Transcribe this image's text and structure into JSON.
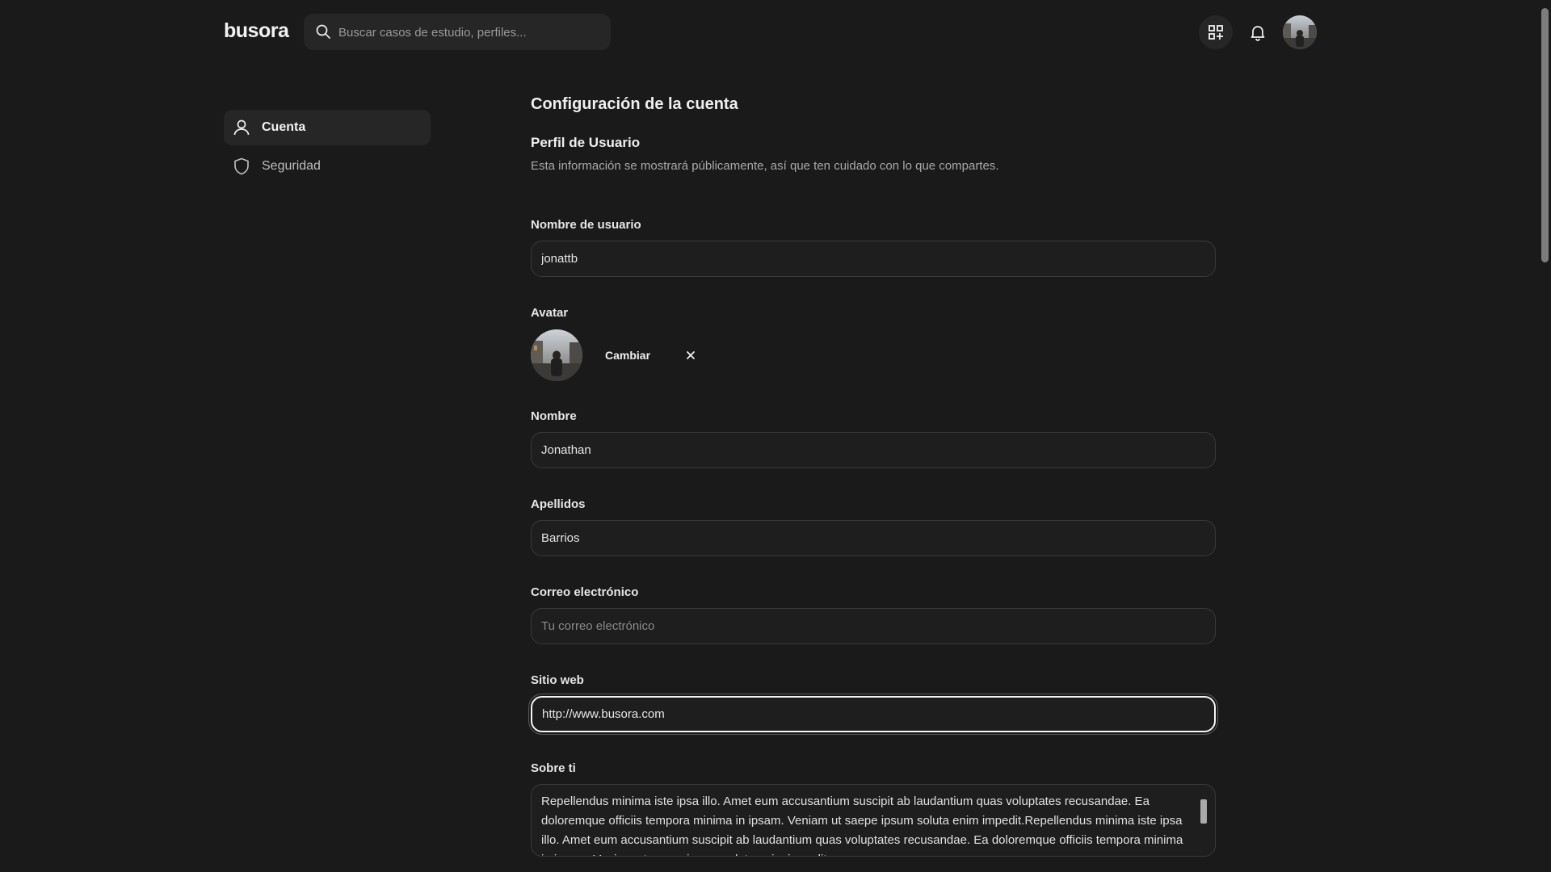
{
  "header": {
    "logo": "busora",
    "search_placeholder": "Buscar casos de estudio, perfiles..."
  },
  "sidebar": {
    "items": [
      {
        "label": "Cuenta",
        "icon": "user-icon",
        "active": true
      },
      {
        "label": "Seguridad",
        "icon": "shield-icon",
        "active": false
      }
    ]
  },
  "main": {
    "title": "Configuración de la cuenta",
    "section_title": "Perfil de Usuario",
    "section_desc": "Esta información se mostrará públicamente, así que ten cuidado con lo que compartes.",
    "username": {
      "label": "Nombre de usuario",
      "value": "jonattb"
    },
    "avatar": {
      "label": "Avatar",
      "change_label": "Cambiar"
    },
    "first_name": {
      "label": "Nombre",
      "value": "Jonathan"
    },
    "last_name": {
      "label": "Apellidos",
      "value": "Barrios"
    },
    "email": {
      "label": "Correo electrónico",
      "value": "",
      "placeholder": "Tu correo electrónico"
    },
    "website": {
      "label": "Sitio web",
      "value": "http://www.busora.com"
    },
    "about": {
      "label": "Sobre ti",
      "value": "Repellendus minima iste ipsa illo. Amet eum accusantium suscipit ab laudantium quas voluptates recusandae. Ea doloremque officiis tempora minima in ipsam. Veniam ut saepe ipsum soluta enim impedit.Repellendus minima iste ipsa illo. Amet eum accusantium suscipit ab laudantium quas voluptates recusandae. Ea doloremque officiis tempora minima in ipsam. Veniam ut saepe ipsum soluta enim impedit."
    }
  },
  "colors": {
    "background": "#1a1a1a",
    "surface": "#262626",
    "border": "#3a3a3a",
    "focus": "#f4f4f4"
  }
}
